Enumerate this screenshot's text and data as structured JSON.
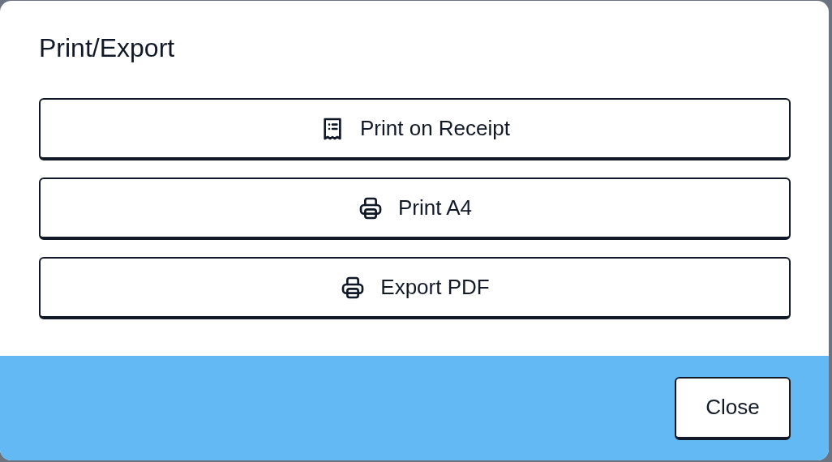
{
  "dialog": {
    "title": "Print/Export",
    "options": [
      {
        "label": "Print on Receipt",
        "kind": "receipt"
      },
      {
        "label": "Print A4",
        "kind": "printer"
      },
      {
        "label": "Export PDF",
        "kind": "printer"
      }
    ],
    "footer_buttons": [
      "Close"
    ]
  }
}
